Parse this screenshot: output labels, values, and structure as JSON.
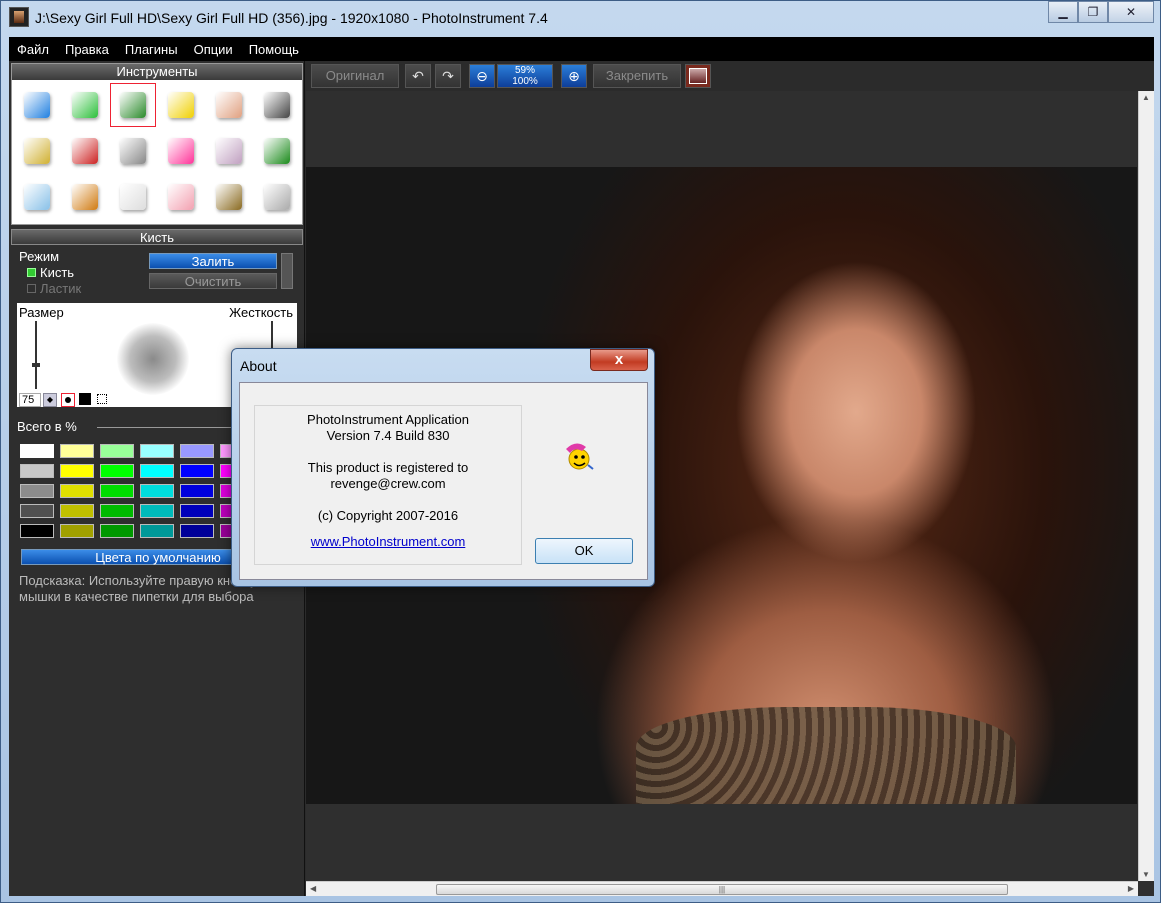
{
  "window": {
    "title": "J:\\Sexy Girl Full HD\\Sexy Girl Full HD (356).jpg - 1920x1080 - PhotoInstrument 7.4"
  },
  "menu": [
    "Файл",
    "Правка",
    "Плагины",
    "Опции",
    "Помощь"
  ],
  "tools_panel": {
    "title": "Инструменты",
    "icons": [
      "drop-icon",
      "cone-icon",
      "pencil-brush-icon",
      "stamp-icon",
      "finger-icon",
      "pin-tool-icon",
      "shield-icon",
      "eye-icon",
      "gradient-bw-icon",
      "rainbow-icon",
      "lines-icon",
      "scissors-pin-icon",
      "tube-icon",
      "bottle-icon",
      "bulb-icon",
      "eraser-icon",
      "tv-icon",
      "text-stack-icon"
    ],
    "selected_index": 2
  },
  "brush_panel": {
    "title": "Кисть",
    "mode_label": "Режим",
    "mode_brush": "Кисть",
    "mode_eraser": "Ластик",
    "fill_button": "Залить",
    "clear_button": "Очистить",
    "size_label": "Размер",
    "hardness_label": "Жесткость",
    "size_value": "75",
    "total_label": "Всего в %",
    "defaults_button": "Цвета по умолчанию",
    "hint": "Подсказка: Используйте правую кнопку мышки в качестве пипетки для выбора",
    "swatches": [
      [
        "#ffffff",
        "#ffff99",
        "#99ff99",
        "#99ffff",
        "#9999ff",
        "#ff99ff"
      ],
      [
        "#c8c8c8",
        "#ffff00",
        "#00ff00",
        "#00ffff",
        "#0000ff",
        "#ff00ff"
      ],
      [
        "#8c8c8c",
        "#e0e000",
        "#00dd00",
        "#00dddd",
        "#0000dd",
        "#dd00dd"
      ],
      [
        "#505050",
        "#c0c000",
        "#00bb00",
        "#00bbbb",
        "#0000bb",
        "#bb00bb"
      ],
      [
        "#000000",
        "#a0a000",
        "#009900",
        "#009999",
        "#000099",
        "#990099"
      ]
    ]
  },
  "toolbar": {
    "original_button": "Оригинал",
    "zoom_top": "59%",
    "zoom_bottom": "100%",
    "pin_button": "Закрепить"
  },
  "dialog": {
    "title": "About",
    "close_label": "x",
    "line1": "PhotoInstrument Application",
    "line2": "Version 7.4 Build 830",
    "line3": "This product is registered to",
    "line4": "revenge@crew.com",
    "line5": "(c) Copyright 2007-2016",
    "link": "www.PhotoInstrument.com",
    "ok_button": "OK"
  }
}
